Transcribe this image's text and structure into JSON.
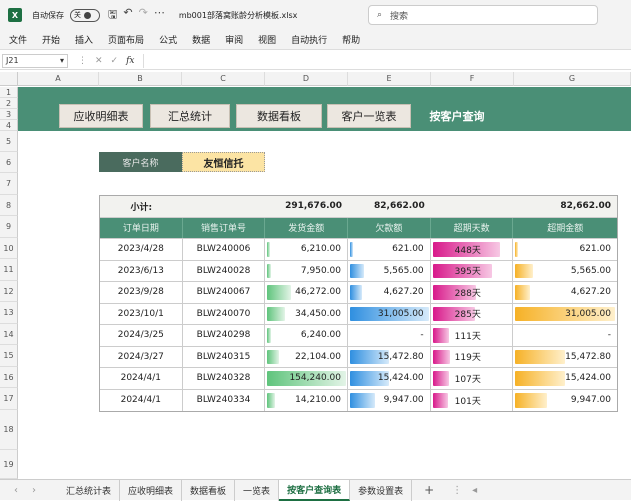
{
  "titlebar": {
    "autosave_label": "自动保存",
    "autosave_state": "关",
    "filename": "mb001部落窝账龄分析模板.xlsx",
    "search_placeholder": "搜索"
  },
  "menu": [
    "文件",
    "开始",
    "插入",
    "页面布局",
    "公式",
    "数据",
    "审阅",
    "视图",
    "自动执行",
    "帮助"
  ],
  "formula_bar": {
    "cell_ref": "J21",
    "fx": "fx"
  },
  "columns": [
    "A",
    "B",
    "C",
    "D",
    "E",
    "F",
    "G"
  ],
  "rows": [
    "1",
    "2",
    "3",
    "4",
    "5",
    "6",
    "7",
    "8",
    "9",
    "10",
    "11",
    "12",
    "13",
    "14",
    "15",
    "16",
    "17",
    "18",
    "19"
  ],
  "nav_buttons": [
    {
      "label": "应收明细表"
    },
    {
      "label": "汇总统计"
    },
    {
      "label": "数据看板"
    },
    {
      "label": "客户一览表"
    },
    {
      "label": "按客户查询"
    }
  ],
  "customer": {
    "label": "客户名称",
    "value": "友恒信托"
  },
  "subtotal": {
    "label": "小计:",
    "shipped": "291,676.00",
    "owed": "82,662.00",
    "overdue_amount": "82,662.00"
  },
  "table_headers": [
    "订单日期",
    "销售订单号",
    "发货金额",
    "欠款额",
    "超期天数",
    "超期金额"
  ],
  "table_rows": [
    {
      "date": "2023/4/28",
      "order": "BLW240006",
      "shipped": "6,210.00",
      "owed": "621.00",
      "days": "448天",
      "overdue": "621.00",
      "shipped_v": 6210,
      "owed_v": 621,
      "days_v": 448,
      "overdue_v": 621
    },
    {
      "date": "2023/6/13",
      "order": "BLW240028",
      "shipped": "7,950.00",
      "owed": "5,565.00",
      "days": "395天",
      "overdue": "5,565.00",
      "shipped_v": 7950,
      "owed_v": 5565,
      "days_v": 395,
      "overdue_v": 5565
    },
    {
      "date": "2023/9/28",
      "order": "BLW240067",
      "shipped": "46,272.00",
      "owed": "4,627.20",
      "days": "288天",
      "overdue": "4,627.20",
      "shipped_v": 46272,
      "owed_v": 4627.2,
      "days_v": 288,
      "overdue_v": 4627.2
    },
    {
      "date": "2023/10/1",
      "order": "BLW240070",
      "shipped": "34,450.00",
      "owed": "31,005.00",
      "days": "285天",
      "overdue": "31,005.00",
      "shipped_v": 34450,
      "owed_v": 31005,
      "days_v": 285,
      "overdue_v": 31005
    },
    {
      "date": "2024/3/25",
      "order": "BLW240298",
      "shipped": "6,240.00",
      "owed": "-",
      "days": "111天",
      "overdue": "-",
      "shipped_v": 6240,
      "owed_v": 0,
      "days_v": 111,
      "overdue_v": 0
    },
    {
      "date": "2024/3/27",
      "order": "BLW240315",
      "shipped": "22,104.00",
      "owed": "15,472.80",
      "days": "119天",
      "overdue": "15,472.80",
      "shipped_v": 22104,
      "owed_v": 15472.8,
      "days_v": 119,
      "overdue_v": 15472.8
    },
    {
      "date": "2024/4/1",
      "order": "BLW240328",
      "shipped": "154,240.00",
      "owed": "15,424.00",
      "days": "107天",
      "overdue": "15,424.00",
      "shipped_v": 154240,
      "owed_v": 15424,
      "days_v": 107,
      "overdue_v": 15424
    },
    {
      "date": "2024/4/1",
      "order": "BLW240334",
      "shipped": "14,210.00",
      "owed": "9,947.00",
      "days": "101天",
      "overdue": "9,947.00",
      "shipped_v": 14210,
      "owed_v": 9947,
      "days_v": 101,
      "overdue_v": 9947
    }
  ],
  "sheet_tabs": [
    {
      "label": "汇总统计表",
      "active": false
    },
    {
      "label": "应收明细表",
      "active": false
    },
    {
      "label": "数据看板",
      "active": false
    },
    {
      "label": "一览表",
      "active": false
    },
    {
      "label": "按客户查询表",
      "active": true
    },
    {
      "label": "参数设置表",
      "active": false
    }
  ],
  "colors": {
    "accent": "#4a8f76",
    "excel_green": "#1d6f42",
    "highlight": "#fce4a4"
  }
}
